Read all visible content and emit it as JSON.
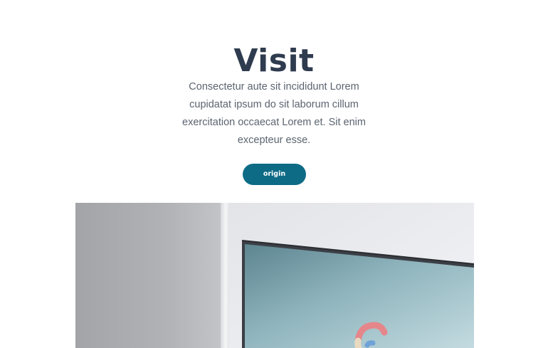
{
  "hero": {
    "title": "Visit",
    "description_lines": [
      "Consectetur aute sit incididunt Lorem",
      "cupidatat ipsum do sit laborum cillum",
      "exercitation occaecat Lorem et. Sit enim",
      "excepteur esse."
    ],
    "button_label": "origin"
  },
  "colors": {
    "title": "#2f3b4e",
    "body_text": "#5b6470",
    "button_bg": "#0e6b86",
    "button_text": "#ffffff",
    "background": "#ffffff"
  }
}
